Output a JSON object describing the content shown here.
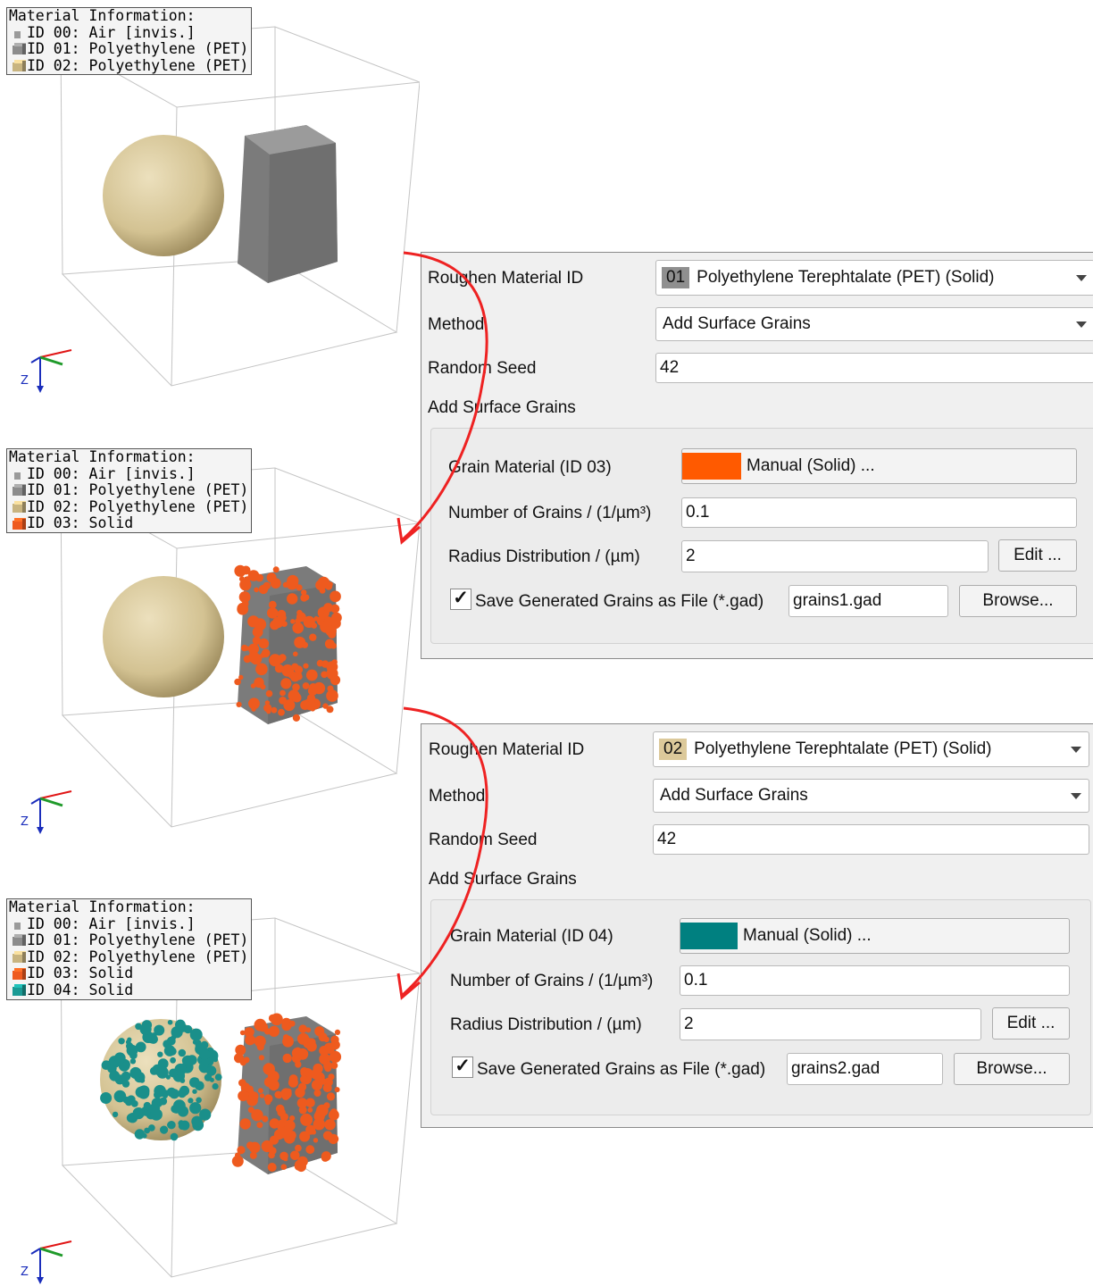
{
  "legends": [
    {
      "title": "Material Information:",
      "rows": [
        {
          "label": "ID 00: Air [invis.]",
          "color": "#9a9a9a"
        },
        {
          "label": "ID 01: Polyethylene (PET)",
          "color": "#8c8c8c"
        },
        {
          "label": "ID 02: Polyethylene (PET)",
          "color": "#c8b480"
        }
      ]
    },
    {
      "title": "Material Information:",
      "rows": [
        {
          "label": "ID 00: Air [invis.]",
          "color": "#9a9a9a"
        },
        {
          "label": "ID 01: Polyethylene (PET)",
          "color": "#8c8c8c"
        },
        {
          "label": "ID 02: Polyethylene (PET)",
          "color": "#c8b480"
        },
        {
          "label": "ID 03: Solid",
          "color": "#ee5a1e"
        }
      ]
    },
    {
      "title": "Material Information:",
      "rows": [
        {
          "label": "ID 00: Air [invis.]",
          "color": "#9a9a9a"
        },
        {
          "label": "ID 01: Polyethylene (PET)",
          "color": "#8c8c8c"
        },
        {
          "label": "ID 02: Polyethylene (PET)",
          "color": "#c8b480"
        },
        {
          "label": "ID 03: Solid",
          "color": "#ee5a1e"
        },
        {
          "label": "ID 04: Solid",
          "color": "#1a9a94"
        }
      ]
    }
  ],
  "axis_label": "Z",
  "panels": [
    {
      "roughen_label": "Roughen Material ID",
      "roughen_id": "01",
      "roughen_id_color": "#8f8f8f",
      "roughen_material": "Polyethylene Terephtalate (PET) (Solid)",
      "method_label": "Method",
      "method_value": "Add Surface Grains",
      "seed_label": "Random Seed",
      "seed_value": "42",
      "section_title": "Add Surface Grains",
      "grain_material_label": "Grain Material (ID 03)",
      "grain_color": "#ff5a00",
      "grain_material_value": "Manual (Solid) ...",
      "num_grains_label": "Number of Grains / (1/µm³)",
      "num_grains_value": "0.1",
      "radius_label": "Radius Distribution / (µm)",
      "radius_value": "2",
      "edit_label": "Edit ...",
      "save_checked": "✓",
      "save_label": "Save Generated Grains as File (*.gad)",
      "file_value": "grains1.gad",
      "browse_label": "Browse..."
    },
    {
      "roughen_label": "Roughen Material ID",
      "roughen_id": "02",
      "roughen_id_color": "#dcc99a",
      "roughen_material": "Polyethylene Terephtalate (PET) (Solid)",
      "method_label": "Method",
      "method_value": "Add Surface Grains",
      "seed_label": "Random Seed",
      "seed_value": "42",
      "section_title": "Add Surface Grains",
      "grain_material_label": "Grain Material (ID 04)",
      "grain_color": "#008080",
      "grain_material_value": "Manual (Solid) ...",
      "num_grains_label": "Number of Grains / (1/µm³)",
      "num_grains_value": "0.1",
      "radius_label": "Radius Distribution / (µm)",
      "radius_value": "2",
      "edit_label": "Edit ...",
      "save_checked": "✓",
      "save_label": "Save Generated Grains as File (*.gad)",
      "file_value": "grains2.gad",
      "browse_label": "Browse..."
    }
  ],
  "colors": {
    "sphere": "#d6c597",
    "box": "#7d7d7d",
    "grain_orange": "#ee5a1e",
    "grain_teal": "#1a8f8a",
    "arrow": "#ee2222"
  }
}
